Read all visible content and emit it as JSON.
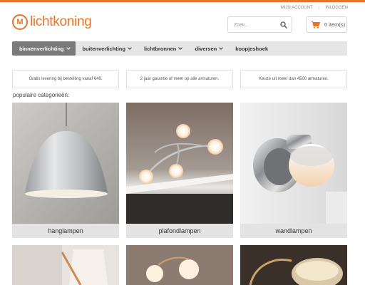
{
  "header": {
    "account_link": "MIJN ACCOUNT",
    "login_link": "INLOGGEN",
    "logo_mark": "M",
    "logo_text": "lichtkoning",
    "search_placeholder": "Zoek..",
    "cart_label": "0 item(s)"
  },
  "nav": {
    "items": [
      {
        "label": "binnenverlichting",
        "has_dropdown": true,
        "active": true
      },
      {
        "label": "buitenverlichting",
        "has_dropdown": true,
        "active": false
      },
      {
        "label": "lichtbronnen",
        "has_dropdown": true,
        "active": false
      },
      {
        "label": "diversen",
        "has_dropdown": true,
        "active": false
      },
      {
        "label": "koopjeshoek",
        "has_dropdown": false,
        "active": false
      }
    ]
  },
  "usps": [
    "Gratis levering bij bestelling vanaf €49.",
    "2 jaar garantie of meer op alle armaturen.",
    "Keuze uit meer dan 4500 armaturen."
  ],
  "categories_title": "populaire categorieën:",
  "categories": [
    {
      "label": "hanglampen"
    },
    {
      "label": "plafondlampen"
    },
    {
      "label": "wandlampen"
    }
  ],
  "colors": {
    "brand": "#e8742a",
    "nav_bg": "#e6e6e6",
    "nav_active": "#7a7a7a",
    "caption_bg": "#e3e3e3"
  }
}
